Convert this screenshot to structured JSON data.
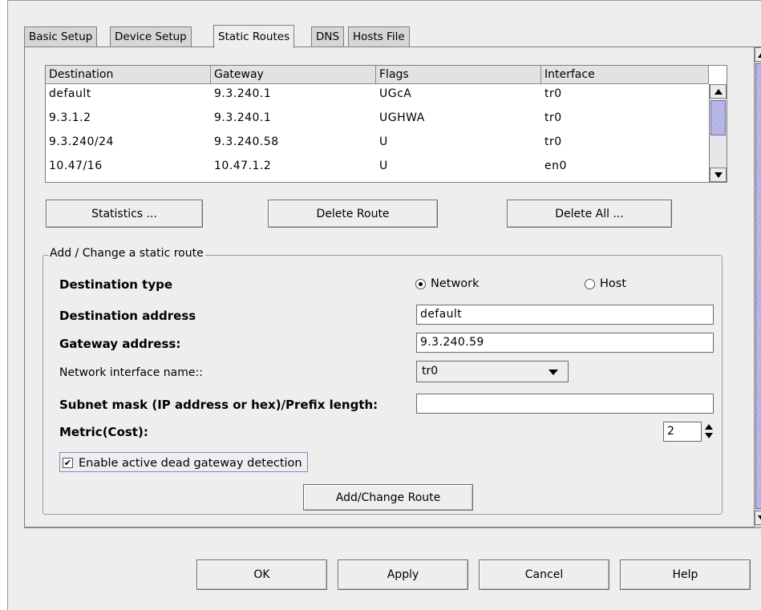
{
  "tabs": [
    "Basic Setup",
    "Device Setup",
    "Static Routes",
    "DNS",
    "Hosts File"
  ],
  "active_tab": "Static Routes",
  "routes": {
    "columns": [
      "Destination",
      "Gateway",
      "Flags",
      "Interface"
    ],
    "rows": [
      {
        "destination": "default",
        "gateway": "9.3.240.1",
        "flags": "UGcA",
        "interface": "tr0"
      },
      {
        "destination": "9.3.1.2",
        "gateway": "9.3.240.1",
        "flags": "UGHWA",
        "interface": "tr0"
      },
      {
        "destination": "9.3.240/24",
        "gateway": "9.3.240.58",
        "flags": "U",
        "interface": "tr0"
      },
      {
        "destination": "10.47/16",
        "gateway": "10.47.1.2",
        "flags": "U",
        "interface": "en0"
      }
    ]
  },
  "actions": {
    "statistics": "Statistics ...",
    "delete_route": "Delete Route",
    "delete_all": "Delete All ..."
  },
  "form": {
    "legend": "Add / Change a static route",
    "destination_type_label": "Destination type",
    "radio_network": "Network",
    "radio_host": "Host",
    "selected_type": "Network",
    "destination_address_label": "Destination address",
    "destination_address_value": "default",
    "gateway_address_label": "Gateway address:",
    "gateway_address_value": "9.3.240.59",
    "interface_label": "Network interface name::",
    "interface_value": "tr0",
    "subnet_label": "Subnet mask (IP address or hex)/Prefix length:",
    "subnet_value": "",
    "metric_label": "Metric(Cost):",
    "metric_value": "2",
    "dead_gateway_label": "Enable active dead gateway detection",
    "dead_gateway_checked": true,
    "add_change_button": "Add/Change Route"
  },
  "footer": {
    "ok": "OK",
    "apply": "Apply",
    "cancel": "Cancel",
    "help": "Help"
  },
  "colors": {
    "window_bg": "#eeeeee",
    "scroll_thumb": "#b3b3e6"
  },
  "icons": {
    "check_mark": "✔"
  }
}
